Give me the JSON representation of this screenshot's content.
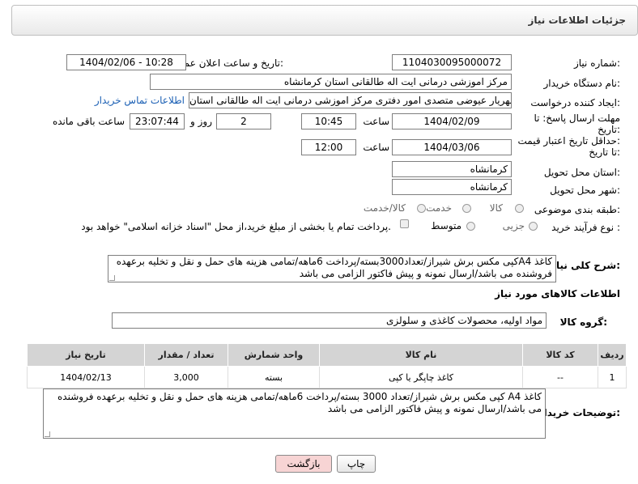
{
  "panel": {
    "title": "جزئیات اطلاعات نیاز"
  },
  "fields": {
    "need_number_label": "شماره نیاز:",
    "need_number": "1104030095000072",
    "announce_label": "تاریخ و ساعت اعلان عمومی:",
    "announce_value": "1404/02/06 - 10:28",
    "buyer_org_label": "نام دستگاه خریدار:",
    "buyer_org": "مرکز اموزشی درمانی ایت اله طالقانی استان کرمانشاه",
    "creator_label": "ایجاد کننده درخواست:",
    "creator": "شهریار عیوضی متصدی امور دفتری مرکز اموزشی درمانی ایت اله طالقانی استان",
    "contact_link": "اطلاعات تماس خریدار",
    "deadline_label_1": "مهلت ارسال پاسخ: تا",
    "deadline_label_2": "تاریخ:",
    "deadline_date": "1404/02/09",
    "time_label": "ساعت",
    "deadline_time": "10:45",
    "days_value": "2",
    "days_label": "روز و",
    "remaining_time": "23:07:44",
    "remaining_label": "ساعت باقی مانده",
    "validity_label_1": "حداقل تاریخ اعتبار قیمت:",
    "validity_label_2": "تا تاریخ:",
    "validity_date": "1404/03/06",
    "validity_time": "12:00",
    "province_label": "استان محل تحویل:",
    "province": "کرمانشاه",
    "city_label": "شهر محل تحویل:",
    "city": "کرمانشاه",
    "category_label": "طبقه بندی موضوعی:",
    "category_options": [
      "کالا",
      "خدمت",
      "کالا/خدمت"
    ],
    "process_label": "نوع فرآیند خرید :",
    "process_options": [
      "جزیی",
      "متوسط"
    ],
    "payment_note": "پرداخت تمام یا بخشی از مبلغ خرید،از محل \"اسناد خزانه اسلامی\" خواهد بود."
  },
  "description": {
    "label": "شرح کلی نیاز:",
    "text": "کاغذ A4کپی مکس برش شیراز/تعداد3000بسته/پرداخت 6ماهه/تمامی هزینه های حمل و نقل و تخلیه برعهده فروشنده می باشد/ارسال نمونه و پیش فاکتور الزامی می باشد"
  },
  "goods": {
    "section_title": "اطلاعات کالاهای مورد نیاز",
    "group_label": "گروه کالا:",
    "group_value": "مواد اولیه، محصولات کاغذی و سلولزی",
    "columns": [
      "ردیف",
      "کد کالا",
      "نام کالا",
      "واحد شمارش",
      "تعداد / مقدار",
      "تاریخ نیاز"
    ],
    "rows": [
      {
        "row": "1",
        "code": "--",
        "name": "کاغذ چاپگر یا کپی",
        "unit": "بسته",
        "qty": "3,000",
        "date": "1404/02/13"
      }
    ]
  },
  "buyer_notes": {
    "label": "توضیحات خریدار:",
    "text": "کاغذ A4 کپی مکس برش شیراز/تعداد 3000 بسته/پرداخت 6ماهه/تمامی هزینه های حمل و نقل و تخلیه برعهده فروشنده می باشد/ارسال نمونه و پیش فاکتور الزامی می باشد"
  },
  "buttons": {
    "print": "چاپ",
    "back": "بازگشت"
  },
  "colors": {
    "back_button_bg": "#f7d4d4",
    "link": "#1a5fb4",
    "table_header": "#d4d4d4"
  }
}
